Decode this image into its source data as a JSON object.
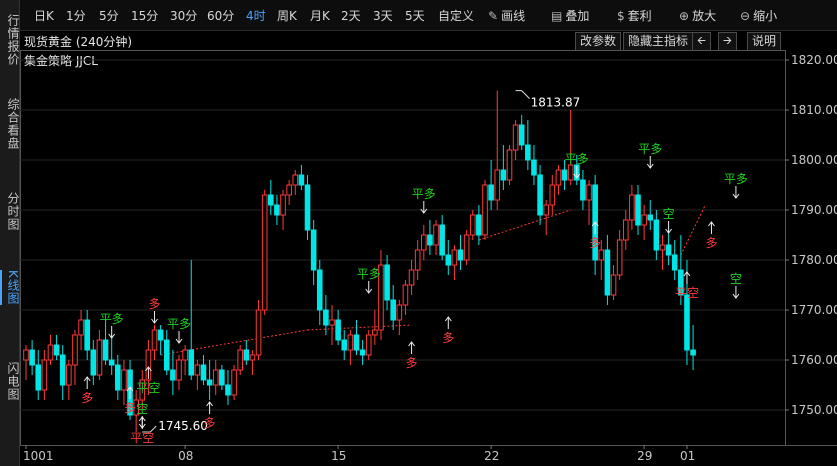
{
  "sidebar": {
    "tabs": [
      {
        "label": "行情报价",
        "active": false
      },
      {
        "label": "综合看盘",
        "active": false
      },
      {
        "label": "分时图",
        "active": false
      },
      {
        "label": "K线图",
        "active": true
      },
      {
        "label": "闪电图",
        "active": false
      }
    ]
  },
  "toolbar": {
    "periods": [
      {
        "label": "日K",
        "active": false
      },
      {
        "label": "1分",
        "active": false
      },
      {
        "label": "5分",
        "active": false
      },
      {
        "label": "15分",
        "active": false
      },
      {
        "label": "30分",
        "active": false
      },
      {
        "label": "60分",
        "active": false
      },
      {
        "label": "4时",
        "active": true
      },
      {
        "label": "周K",
        "active": false
      },
      {
        "label": "月K",
        "active": false
      },
      {
        "label": "2天",
        "active": false
      },
      {
        "label": "3天",
        "active": false
      },
      {
        "label": "5天",
        "active": false
      },
      {
        "label": "自定义",
        "active": false
      }
    ],
    "tools": [
      {
        "label": "画线",
        "icon": "pen-icon"
      },
      {
        "label": "叠加",
        "icon": "layers-icon"
      },
      {
        "label": "套利",
        "icon": "moneybag-icon"
      },
      {
        "label": "放大",
        "icon": "zoom-in-icon"
      },
      {
        "label": "缩小",
        "icon": "zoom-out-icon"
      }
    ]
  },
  "titlebar": {
    "title": "现货黄金 (240分钟)",
    "strategy": "集金策略 JJCL",
    "buttons": {
      "params": "改参数",
      "hide": "隐藏主指标",
      "help": "说明"
    }
  },
  "colors": {
    "up": "#ff3b3b",
    "down": "#00e5e5",
    "signal_green": "#1ed21e",
    "signal_red": "#ff3b3b"
  },
  "chart_data": {
    "type": "candlestick",
    "y_ticks": [
      1820,
      1810,
      1800,
      1790,
      1780,
      1770,
      1760,
      1750
    ],
    "ylim": [
      1743,
      1822
    ],
    "x_labels": [
      {
        "text": "1001",
        "i": 0
      },
      {
        "text": "08",
        "i": 26
      },
      {
        "text": "15",
        "i": 51
      },
      {
        "text": "22",
        "i": 76
      },
      {
        "text": "29",
        "i": 101
      },
      {
        "text": "01",
        "i": 108
      }
    ],
    "annotations": [
      {
        "text": "1813.87",
        "i": 80,
        "value": 1813.87,
        "kind": "high"
      },
      {
        "text": "1745.60",
        "i": 19,
        "value": 1745.6,
        "kind": "low"
      }
    ],
    "signals": [
      {
        "text": "平多",
        "i": 14,
        "color": "green",
        "dir": "down",
        "price": 1764
      },
      {
        "text": "多",
        "i": 10,
        "color": "red",
        "dir": "up",
        "price": 1757
      },
      {
        "text": "多",
        "i": 17,
        "color": "red",
        "dir": "up",
        "price": 1755
      },
      {
        "text": "平空",
        "i": 19,
        "color": "red",
        "dir": "up",
        "price": 1749
      },
      {
        "text": "空",
        "i": 19,
        "color": "green",
        "dir": "down",
        "price": 1746
      },
      {
        "text": "多",
        "i": 21,
        "color": "red",
        "dir": "down",
        "price": 1767
      },
      {
        "text": "平空",
        "i": 20,
        "color": "green",
        "dir": "up",
        "price": 1759
      },
      {
        "text": "平多",
        "i": 25,
        "color": "green",
        "dir": "down",
        "price": 1763
      },
      {
        "text": "多",
        "i": 30,
        "color": "red",
        "dir": "up",
        "price": 1752
      },
      {
        "text": "平多",
        "i": 56,
        "color": "green",
        "dir": "down",
        "price": 1773
      },
      {
        "text": "多",
        "i": 63,
        "color": "red",
        "dir": "up",
        "price": 1764
      },
      {
        "text": "平多",
        "i": 65,
        "color": "green",
        "dir": "down",
        "price": 1789
      },
      {
        "text": "多",
        "i": 69,
        "color": "red",
        "dir": "up",
        "price": 1769
      },
      {
        "text": "平多",
        "i": 90,
        "color": "green",
        "dir": "down",
        "price": 1796
      },
      {
        "text": "多",
        "i": 93,
        "color": "red",
        "dir": "up",
        "price": 1788
      },
      {
        "text": "平多",
        "i": 102,
        "color": "green",
        "dir": "down",
        "price": 1798
      },
      {
        "text": "空",
        "i": 105,
        "color": "green",
        "dir": "down",
        "price": 1785
      },
      {
        "text": "平空",
        "i": 108,
        "color": "red",
        "dir": "up",
        "price": 1778
      },
      {
        "text": "多",
        "i": 112,
        "color": "red",
        "dir": "up",
        "price": 1788
      },
      {
        "text": "平多",
        "i": 116,
        "color": "green",
        "dir": "down",
        "price": 1792
      },
      {
        "text": "空",
        "i": 116,
        "color": "green",
        "dir": "down",
        "price": 1772
      }
    ],
    "guide_lines": [
      {
        "from_i": 19,
        "from_v": 1745.6,
        "to_i": 19,
        "to_v": 1745.6
      },
      {
        "from_i": 22,
        "from_v": 1761,
        "to_i": 46,
        "to_v": 1766
      },
      {
        "from_i": 46,
        "from_v": 1766,
        "to_i": 63,
        "to_v": 1767
      },
      {
        "from_i": 74,
        "from_v": 1784,
        "to_i": 89,
        "to_v": 1790
      },
      {
        "from_i": 107,
        "from_v": 1781,
        "to_i": 111,
        "to_v": 1791
      }
    ],
    "candles": [
      {
        "o": 1760,
        "h": 1763,
        "l": 1756,
        "c": 1762
      },
      {
        "o": 1762,
        "h": 1764,
        "l": 1757,
        "c": 1759
      },
      {
        "o": 1759,
        "h": 1762,
        "l": 1752,
        "c": 1754
      },
      {
        "o": 1754,
        "h": 1762,
        "l": 1752,
        "c": 1760
      },
      {
        "o": 1760,
        "h": 1765,
        "l": 1759,
        "c": 1763
      },
      {
        "o": 1763,
        "h": 1765,
        "l": 1760,
        "c": 1761
      },
      {
        "o": 1761,
        "h": 1763,
        "l": 1752,
        "c": 1755
      },
      {
        "o": 1755,
        "h": 1760,
        "l": 1752,
        "c": 1759
      },
      {
        "o": 1759,
        "h": 1766,
        "l": 1755,
        "c": 1765
      },
      {
        "o": 1765,
        "h": 1770,
        "l": 1762,
        "c": 1768
      },
      {
        "o": 1768,
        "h": 1770,
        "l": 1760,
        "c": 1762
      },
      {
        "o": 1762,
        "h": 1764,
        "l": 1755,
        "c": 1757
      },
      {
        "o": 1757,
        "h": 1766,
        "l": 1756,
        "c": 1764
      },
      {
        "o": 1764,
        "h": 1768,
        "l": 1759,
        "c": 1760
      },
      {
        "o": 1760,
        "h": 1765,
        "l": 1757,
        "c": 1759
      },
      {
        "o": 1759,
        "h": 1761,
        "l": 1752,
        "c": 1754
      },
      {
        "o": 1754,
        "h": 1760,
        "l": 1751,
        "c": 1758
      },
      {
        "o": 1758,
        "h": 1760,
        "l": 1748,
        "c": 1749
      },
      {
        "o": 1749,
        "h": 1754,
        "l": 1745.6,
        "c": 1752
      },
      {
        "o": 1752,
        "h": 1758,
        "l": 1750,
        "c": 1756
      },
      {
        "o": 1756,
        "h": 1764,
        "l": 1753,
        "c": 1762
      },
      {
        "o": 1762,
        "h": 1767,
        "l": 1760,
        "c": 1766
      },
      {
        "o": 1766,
        "h": 1767,
        "l": 1761,
        "c": 1764
      },
      {
        "o": 1764,
        "h": 1766,
        "l": 1757,
        "c": 1758
      },
      {
        "o": 1758,
        "h": 1762,
        "l": 1753,
        "c": 1756
      },
      {
        "o": 1756,
        "h": 1761,
        "l": 1754,
        "c": 1760
      },
      {
        "o": 1760,
        "h": 1763,
        "l": 1757,
        "c": 1762
      },
      {
        "o": 1762,
        "h": 1780,
        "l": 1756,
        "c": 1757
      },
      {
        "o": 1757,
        "h": 1760,
        "l": 1754,
        "c": 1759
      },
      {
        "o": 1759,
        "h": 1761,
        "l": 1755,
        "c": 1756
      },
      {
        "o": 1756,
        "h": 1760,
        "l": 1752,
        "c": 1755
      },
      {
        "o": 1755,
        "h": 1760,
        "l": 1753,
        "c": 1758
      },
      {
        "o": 1758,
        "h": 1759,
        "l": 1754,
        "c": 1755
      },
      {
        "o": 1755,
        "h": 1758,
        "l": 1751,
        "c": 1753
      },
      {
        "o": 1753,
        "h": 1759,
        "l": 1752,
        "c": 1758
      },
      {
        "o": 1758,
        "h": 1763,
        "l": 1757,
        "c": 1762
      },
      {
        "o": 1762,
        "h": 1764,
        "l": 1759,
        "c": 1760
      },
      {
        "o": 1760,
        "h": 1762,
        "l": 1757,
        "c": 1761
      },
      {
        "o": 1761,
        "h": 1772,
        "l": 1760,
        "c": 1770
      },
      {
        "o": 1770,
        "h": 1794,
        "l": 1769,
        "c": 1793
      },
      {
        "o": 1793,
        "h": 1796,
        "l": 1789,
        "c": 1791
      },
      {
        "o": 1791,
        "h": 1793,
        "l": 1787,
        "c": 1789
      },
      {
        "o": 1789,
        "h": 1794,
        "l": 1786,
        "c": 1793
      },
      {
        "o": 1793,
        "h": 1796,
        "l": 1791,
        "c": 1795
      },
      {
        "o": 1795,
        "h": 1798,
        "l": 1793,
        "c": 1797
      },
      {
        "o": 1797,
        "h": 1799,
        "l": 1794,
        "c": 1795
      },
      {
        "o": 1795,
        "h": 1797,
        "l": 1784,
        "c": 1786
      },
      {
        "o": 1786,
        "h": 1788,
        "l": 1775,
        "c": 1778
      },
      {
        "o": 1778,
        "h": 1780,
        "l": 1767,
        "c": 1770
      },
      {
        "o": 1770,
        "h": 1773,
        "l": 1765,
        "c": 1767
      },
      {
        "o": 1767,
        "h": 1771,
        "l": 1763,
        "c": 1768
      },
      {
        "o": 1768,
        "h": 1770,
        "l": 1763,
        "c": 1764
      },
      {
        "o": 1764,
        "h": 1766,
        "l": 1760,
        "c": 1762
      },
      {
        "o": 1762,
        "h": 1766,
        "l": 1759,
        "c": 1765
      },
      {
        "o": 1765,
        "h": 1768,
        "l": 1761,
        "c": 1762
      },
      {
        "o": 1762,
        "h": 1764,
        "l": 1759,
        "c": 1761
      },
      {
        "o": 1761,
        "h": 1766,
        "l": 1760,
        "c": 1765
      },
      {
        "o": 1765,
        "h": 1770,
        "l": 1763,
        "c": 1766
      },
      {
        "o": 1766,
        "h": 1782,
        "l": 1764,
        "c": 1779
      },
      {
        "o": 1779,
        "h": 1781,
        "l": 1770,
        "c": 1772
      },
      {
        "o": 1772,
        "h": 1775,
        "l": 1766,
        "c": 1768
      },
      {
        "o": 1768,
        "h": 1772,
        "l": 1765,
        "c": 1771
      },
      {
        "o": 1771,
        "h": 1776,
        "l": 1769,
        "c": 1775
      },
      {
        "o": 1775,
        "h": 1780,
        "l": 1773,
        "c": 1778
      },
      {
        "o": 1778,
        "h": 1784,
        "l": 1776,
        "c": 1782
      },
      {
        "o": 1782,
        "h": 1787,
        "l": 1780,
        "c": 1785
      },
      {
        "o": 1785,
        "h": 1788,
        "l": 1781,
        "c": 1783
      },
      {
        "o": 1783,
        "h": 1788,
        "l": 1781,
        "c": 1787
      },
      {
        "o": 1787,
        "h": 1789,
        "l": 1780,
        "c": 1781
      },
      {
        "o": 1781,
        "h": 1784,
        "l": 1777,
        "c": 1779
      },
      {
        "o": 1779,
        "h": 1783,
        "l": 1776,
        "c": 1782
      },
      {
        "o": 1782,
        "h": 1785,
        "l": 1778,
        "c": 1780
      },
      {
        "o": 1780,
        "h": 1786,
        "l": 1779,
        "c": 1785
      },
      {
        "o": 1785,
        "h": 1790,
        "l": 1784,
        "c": 1789
      },
      {
        "o": 1789,
        "h": 1791,
        "l": 1783,
        "c": 1785
      },
      {
        "o": 1785,
        "h": 1796,
        "l": 1784,
        "c": 1795
      },
      {
        "o": 1795,
        "h": 1800,
        "l": 1790,
        "c": 1792
      },
      {
        "o": 1792,
        "h": 1813.87,
        "l": 1790,
        "c": 1798
      },
      {
        "o": 1798,
        "h": 1803,
        "l": 1794,
        "c": 1796
      },
      {
        "o": 1796,
        "h": 1803,
        "l": 1795,
        "c": 1802
      },
      {
        "o": 1802,
        "h": 1808,
        "l": 1800,
        "c": 1807
      },
      {
        "o": 1807,
        "h": 1809,
        "l": 1802,
        "c": 1803
      },
      {
        "o": 1803,
        "h": 1808,
        "l": 1798,
        "c": 1800
      },
      {
        "o": 1800,
        "h": 1803,
        "l": 1795,
        "c": 1797
      },
      {
        "o": 1797,
        "h": 1799,
        "l": 1787,
        "c": 1789
      },
      {
        "o": 1789,
        "h": 1792,
        "l": 1785,
        "c": 1791
      },
      {
        "o": 1791,
        "h": 1797,
        "l": 1789,
        "c": 1795
      },
      {
        "o": 1795,
        "h": 1799,
        "l": 1793,
        "c": 1798
      },
      {
        "o": 1798,
        "h": 1800,
        "l": 1794,
        "c": 1796
      },
      {
        "o": 1796,
        "h": 1810,
        "l": 1795,
        "c": 1799
      },
      {
        "o": 1799,
        "h": 1801,
        "l": 1795,
        "c": 1796
      },
      {
        "o": 1796,
        "h": 1798,
        "l": 1790,
        "c": 1792
      },
      {
        "o": 1792,
        "h": 1796,
        "l": 1787,
        "c": 1795
      },
      {
        "o": 1795,
        "h": 1797,
        "l": 1777,
        "c": 1780
      },
      {
        "o": 1780,
        "h": 1784,
        "l": 1776,
        "c": 1782
      },
      {
        "o": 1782,
        "h": 1785,
        "l": 1771,
        "c": 1773
      },
      {
        "o": 1773,
        "h": 1779,
        "l": 1772,
        "c": 1777
      },
      {
        "o": 1777,
        "h": 1786,
        "l": 1776,
        "c": 1784
      },
      {
        "o": 1784,
        "h": 1790,
        "l": 1782,
        "c": 1788
      },
      {
        "o": 1788,
        "h": 1795,
        "l": 1786,
        "c": 1793
      },
      {
        "o": 1793,
        "h": 1795,
        "l": 1785,
        "c": 1787
      },
      {
        "o": 1787,
        "h": 1791,
        "l": 1784,
        "c": 1789
      },
      {
        "o": 1789,
        "h": 1792,
        "l": 1786,
        "c": 1788
      },
      {
        "o": 1788,
        "h": 1790,
        "l": 1780,
        "c": 1782
      },
      {
        "o": 1782,
        "h": 1785,
        "l": 1778,
        "c": 1783
      },
      {
        "o": 1783,
        "h": 1786,
        "l": 1779,
        "c": 1781
      },
      {
        "o": 1781,
        "h": 1784,
        "l": 1776,
        "c": 1778
      },
      {
        "o": 1778,
        "h": 1785,
        "l": 1771,
        "c": 1773
      },
      {
        "o": 1773,
        "h": 1780,
        "l": 1759,
        "c": 1762
      },
      {
        "o": 1762,
        "h": 1767,
        "l": 1758,
        "c": 1761
      }
    ]
  }
}
